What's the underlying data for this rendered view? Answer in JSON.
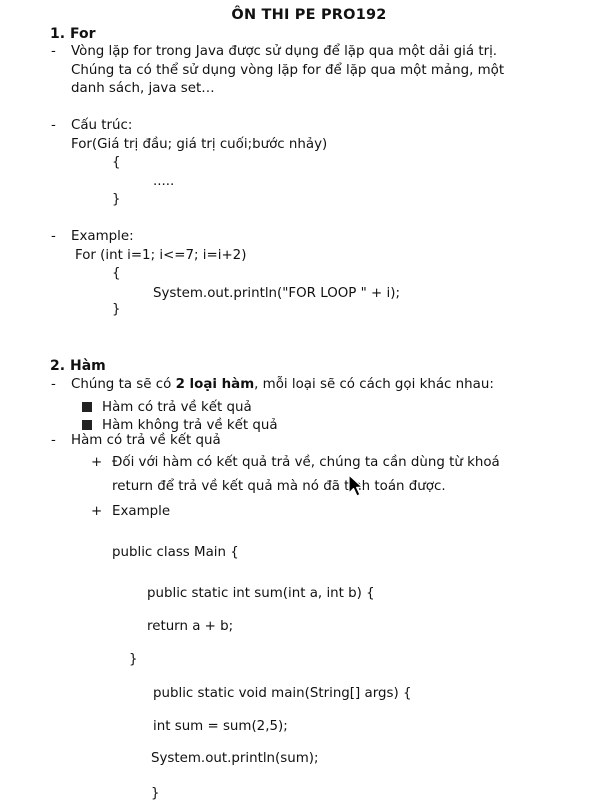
{
  "title": "ÔN THI PE PRO192",
  "sections": [
    {
      "number": "1.",
      "heading": "For"
    },
    {
      "number": "2.",
      "heading": "Hàm"
    }
  ],
  "for_section": {
    "intro_line1": "Vòng lặp for trong Java được sử dụng để lặp qua một dải giá trị.",
    "intro_line2": "Chúng ta có thể sử dụng vòng lặp for để lặp qua một mảng, một",
    "intro_line3": "danh sách, java set…",
    "structure_label": "Cấu trúc:",
    "structure_code": "For(Giá trị đầu; giá trị cuối;bước nhảy)",
    "open_brace": "{",
    "dots": ".....",
    "close_brace": "}",
    "example_label": "Example:",
    "example_line1": "For (int i=1; i<=7; i=i+2)",
    "example_open": "{",
    "example_body": "System.out.println(\"FOR LOOP \" + i);",
    "example_close": "}"
  },
  "ham_section": {
    "intro_pre": "Chúng ta sẽ có ",
    "intro_bold": "2 loại hàm",
    "intro_post": ", mỗi loại sẽ có cách gọi khác nhau:",
    "types": [
      "Hàm có trả về kết quả",
      "Hàm không trả về kết quả"
    ],
    "sub_heading": "Hàm có trả về kết quả",
    "plus1_line1": "Đối với hàm có kết quả trả về, chúng ta cần dùng từ khoá",
    "plus1_line2": "return để trả về kết quả mà nó đã tính toán được.",
    "plus2": "Example",
    "code": [
      "public class Main {",
      "public static int sum(int a, int b) {",
      "return a + b;",
      "}",
      "public static void main(String[] args) {",
      "int sum = sum(2,5);",
      "System.out.println(sum);",
      "}"
    ]
  },
  "markers": {
    "dash": "-",
    "plus": "+"
  },
  "cursor_icon": "mouse-pointer-icon"
}
